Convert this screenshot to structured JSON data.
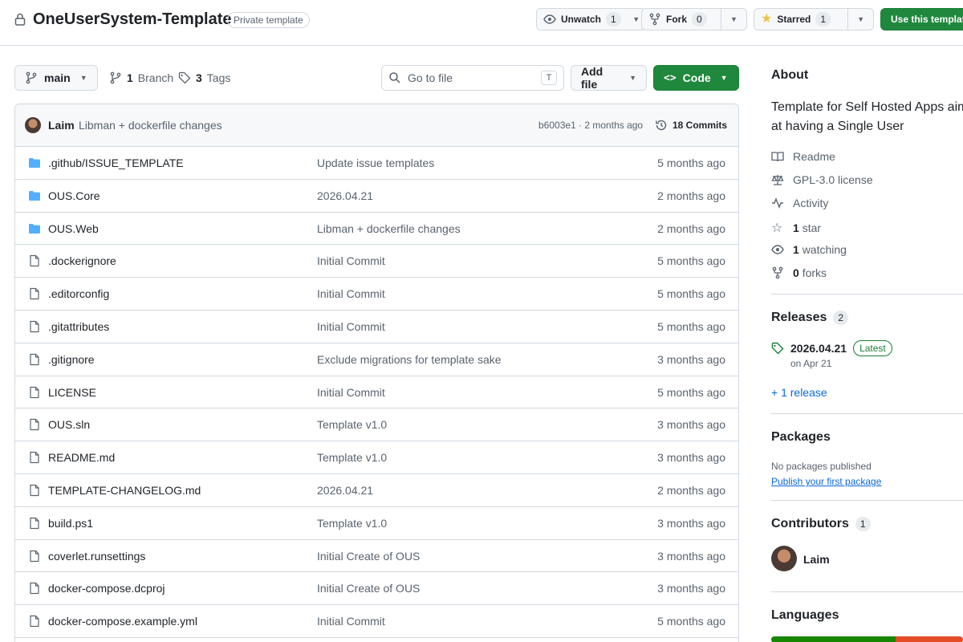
{
  "repo": {
    "name": "OneUserSystem-Template",
    "visibility": "Private template"
  },
  "header_actions": {
    "unwatch_label": "Unwatch",
    "unwatch_count": "1",
    "fork_label": "Fork",
    "fork_count": "0",
    "star_label": "Starred",
    "star_count": "1",
    "use_template_label": "Use this template"
  },
  "toolbar": {
    "branch": "main",
    "branch_count": "1",
    "branch_label": "Branch",
    "tag_count": "3",
    "tag_label": "Tags",
    "search_placeholder": "Go to file",
    "search_shortcut": "T",
    "add_file_label": "Add file",
    "code_label": "Code"
  },
  "last_commit": {
    "author": "Laim",
    "message": "Libman + dockerfile changes",
    "hash_time": "b6003e1 · 2 months ago",
    "commits_label": "18 Commits"
  },
  "files": [
    {
      "type": "dir",
      "name": ".github/ISSUE_TEMPLATE",
      "message": "Update issue templates",
      "date": "5 months ago"
    },
    {
      "type": "dir",
      "name": "OUS.Core",
      "message": "2026.04.21",
      "date": "2 months ago"
    },
    {
      "type": "dir",
      "name": "OUS.Web",
      "message": "Libman + dockerfile changes",
      "date": "2 months ago"
    },
    {
      "type": "file",
      "name": ".dockerignore",
      "message": "Initial Commit",
      "date": "5 months ago"
    },
    {
      "type": "file",
      "name": ".editorconfig",
      "message": "Initial Commit",
      "date": "5 months ago"
    },
    {
      "type": "file",
      "name": ".gitattributes",
      "message": "Initial Commit",
      "date": "5 months ago"
    },
    {
      "type": "file",
      "name": ".gitignore",
      "message": "Exclude migrations for template sake",
      "date": "3 months ago"
    },
    {
      "type": "file",
      "name": "LICENSE",
      "message": "Initial Commit",
      "date": "5 months ago"
    },
    {
      "type": "file",
      "name": "OUS.sln",
      "message": "Template v1.0",
      "date": "3 months ago"
    },
    {
      "type": "file",
      "name": "README.md",
      "message": "Template v1.0",
      "date": "3 months ago"
    },
    {
      "type": "file",
      "name": "TEMPLATE-CHANGELOG.md",
      "message": "2026.04.21",
      "date": "2 months ago"
    },
    {
      "type": "file",
      "name": "build.ps1",
      "message": "Template v1.0",
      "date": "3 months ago"
    },
    {
      "type": "file",
      "name": "coverlet.runsettings",
      "message": "Initial Create of OUS",
      "date": "3 months ago"
    },
    {
      "type": "file",
      "name": "docker-compose.dcproj",
      "message": "Initial Create of OUS",
      "date": "3 months ago"
    },
    {
      "type": "file",
      "name": "docker-compose.example.yml",
      "message": "Initial Commit",
      "date": "5 months ago"
    }
  ],
  "about": {
    "title": "About",
    "description_line1": "Template for Self Hosted Apps aim",
    "description_line2": "at having a Single User",
    "readme": "Readme",
    "license": "GPL-3.0 license",
    "activity": "Activity",
    "stars_count": "1",
    "stars_label": "star",
    "watching_count": "1",
    "watching_label": "watching",
    "forks_count": "0",
    "forks_label": "forks"
  },
  "releases": {
    "title": "Releases",
    "count": "2",
    "latest_version": "2026.04.21",
    "latest_badge": "Latest",
    "latest_date": "on Apr 21",
    "more_link": "+ 1 release"
  },
  "packages": {
    "title": "Packages",
    "empty_text": "No packages published",
    "publish_link": "Publish your first package"
  },
  "contributors": {
    "title": "Contributors",
    "count": "1",
    "name": "Laim"
  },
  "languages": {
    "title": "Languages"
  },
  "colors": {
    "green": "#1f883d",
    "folder_blue": "#54aeff",
    "link_blue": "#0969da",
    "lang_green": "#178600",
    "lang_red": "#e34c26"
  }
}
